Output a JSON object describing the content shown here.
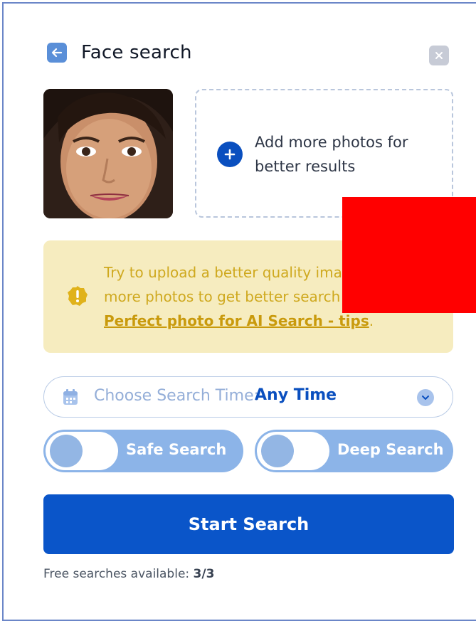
{
  "header": {
    "title": "Face search",
    "back_icon": "arrow-left-icon",
    "close_icon": "close-icon"
  },
  "upload": {
    "add_text": "Add more photos for better results",
    "plus_icon": "plus-icon"
  },
  "warning": {
    "text": "Try to upload a better quality ima",
    "text_line2": "more photos to get better search",
    "link": "Perfect photo for AI Search - tips",
    "link_suffix": ".",
    "icon": "warning-icon"
  },
  "search_time": {
    "label": "Choose Search Time:",
    "value": "Any Time",
    "icon": "calendar-icon",
    "chevron": "chevron-down-icon"
  },
  "toggles": {
    "safe_search": "Safe Search",
    "deep_search": "Deep Search"
  },
  "start_button": "Start Search",
  "footer": {
    "free_label": "Free searches available:",
    "free_count": "3/3"
  },
  "colors": {
    "primary": "#0a55c9",
    "warning_bg": "#f6ecbf",
    "warning_text": "#cfa91f",
    "toggle_bg": "#8cb4e8",
    "redaction": "#ff0000"
  }
}
